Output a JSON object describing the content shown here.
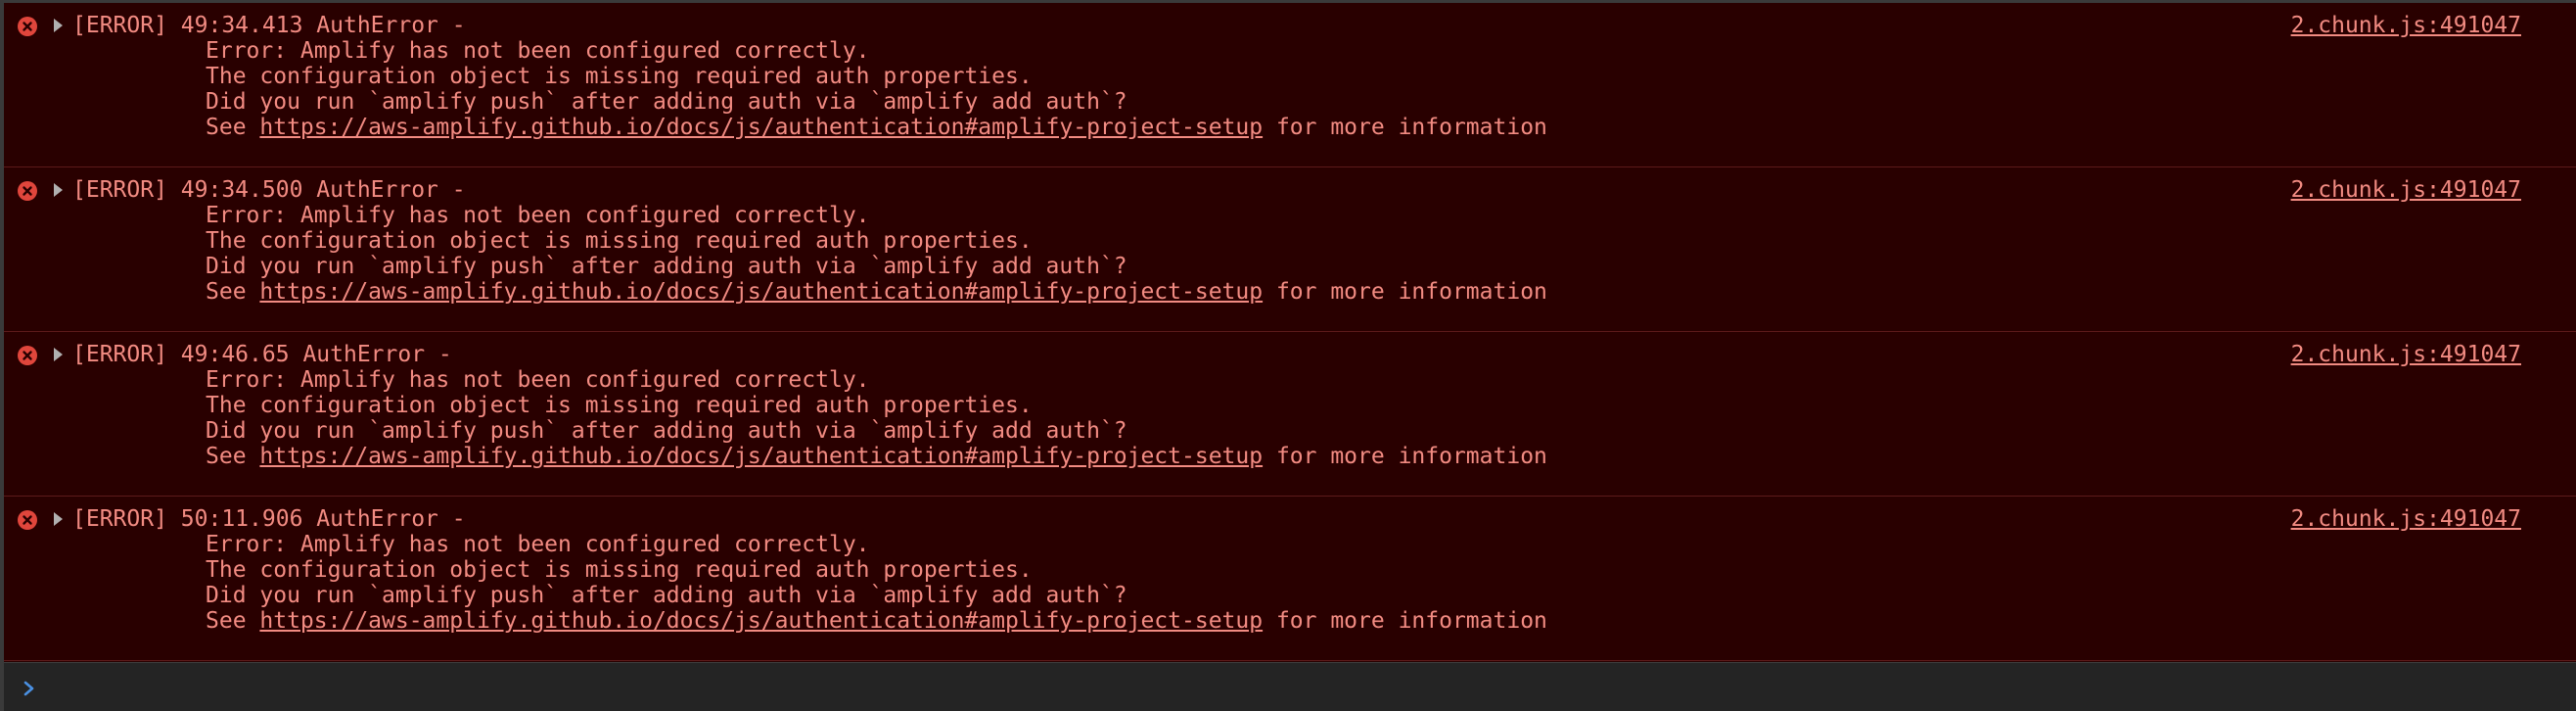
{
  "messages": [
    {
      "level": "[ERROR]",
      "time": "49:34.413",
      "type": "AuthError",
      "sep": "-",
      "line1": "Error: Amplify has not been configured correctly.",
      "line2": "The configuration object is missing required auth properties.",
      "line3": "Did you run `amplify push` after adding auth via `amplify add auth`?",
      "see_prefix": "See ",
      "link": "https://aws-amplify.github.io/docs/js/authentication#amplify-project-setup",
      "see_suffix": " for more information",
      "source": "2.chunk.js:491047"
    },
    {
      "level": "[ERROR]",
      "time": "49:34.500",
      "type": "AuthError",
      "sep": "-",
      "line1": "Error: Amplify has not been configured correctly.",
      "line2": "The configuration object is missing required auth properties.",
      "line3": "Did you run `amplify push` after adding auth via `amplify add auth`?",
      "see_prefix": "See ",
      "link": "https://aws-amplify.github.io/docs/js/authentication#amplify-project-setup",
      "see_suffix": " for more information",
      "source": "2.chunk.js:491047"
    },
    {
      "level": "[ERROR]",
      "time": "49:46.65",
      "type": "AuthError",
      "sep": "-",
      "line1": "Error: Amplify has not been configured correctly.",
      "line2": "The configuration object is missing required auth properties.",
      "line3": "Did you run `amplify push` after adding auth via `amplify add auth`?",
      "see_prefix": "See ",
      "link": "https://aws-amplify.github.io/docs/js/authentication#amplify-project-setup",
      "see_suffix": " for more information",
      "source": "2.chunk.js:491047"
    },
    {
      "level": "[ERROR]",
      "time": "50:11.906",
      "type": "AuthError",
      "sep": "-",
      "line1": "Error: Amplify has not been configured correctly.",
      "line2": "The configuration object is missing required auth properties.",
      "line3": "Did you run `amplify push` after adding auth via `amplify add auth`?",
      "see_prefix": "See ",
      "link": "https://aws-amplify.github.io/docs/js/authentication#amplify-project-setup",
      "see_suffix": " for more information",
      "source": "2.chunk.js:491047"
    }
  ],
  "icons": {
    "error": "error-circle-x-icon",
    "expand": "expand-triangle-icon",
    "prompt": "chevron-right-icon"
  },
  "colors": {
    "background": "#290000",
    "text": "#f28b82",
    "source_link": "#c4c4c4",
    "error_icon": "#e0463c",
    "prompt": "#4a90e2",
    "prompt_bar": "#242424"
  }
}
